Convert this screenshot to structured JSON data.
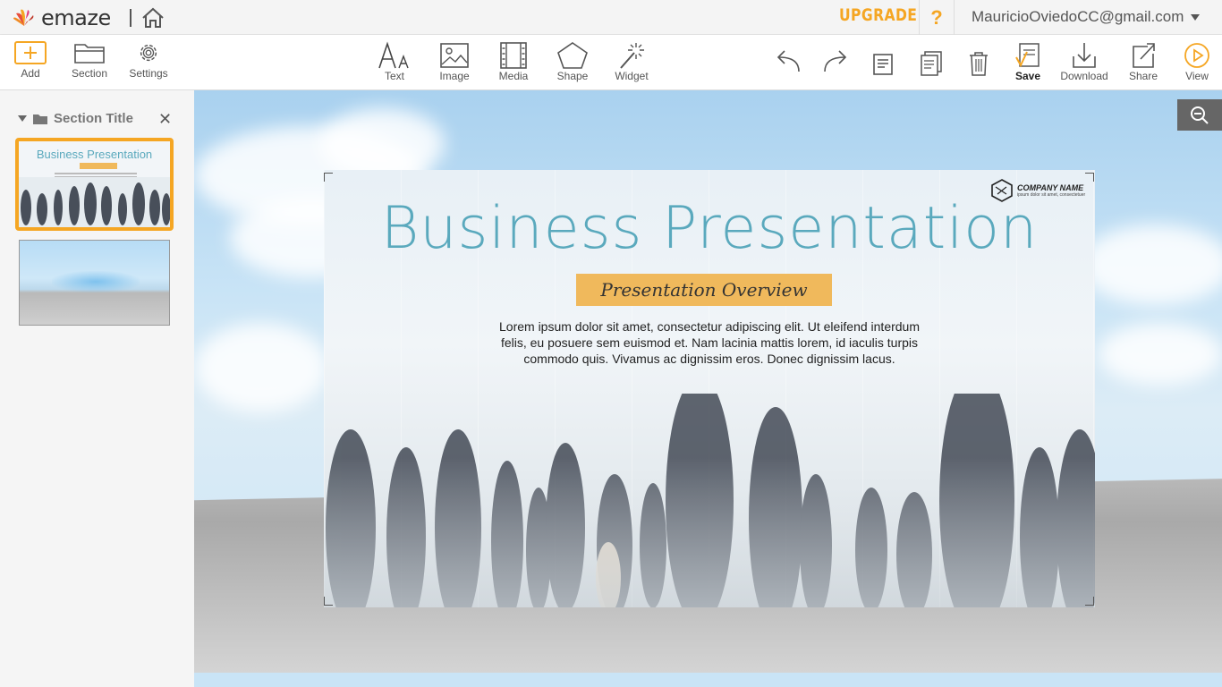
{
  "app": {
    "logo_text": "emaze",
    "upgrade_label": "UPGRADE",
    "help_label": "?",
    "user_email": "MauricioOviedoCC@gmail.com"
  },
  "toolbar": {
    "add": "Add",
    "section": "Section",
    "settings": "Settings",
    "text": "Text",
    "image": "Image",
    "media": "Media",
    "shape": "Shape",
    "widget": "Widget",
    "save": "Save",
    "download": "Download",
    "share": "Share",
    "view": "View"
  },
  "sidebar": {
    "section_title": "Section Title",
    "thumb1_title": "Business Presentation"
  },
  "slide": {
    "title": "Business Presentation",
    "subtitle": "Presentation Overview",
    "body": "Lorem ipsum dolor sit amet, consectetur adipiscing elit. Ut eleifend interdum felis, eu posuere sem euismod et. Nam lacinia mattis lorem, id iaculis turpis commodo quis. Vivamus ac dignissim eros. Donec dignissim lacus.",
    "company_name": "COMPANY NAME",
    "company_sub": "ipsum dolor sit amet, consectetuer"
  },
  "colors": {
    "accent": "#f5a623",
    "title_teal": "#5aa9bd",
    "banner": "#f0b95c"
  }
}
